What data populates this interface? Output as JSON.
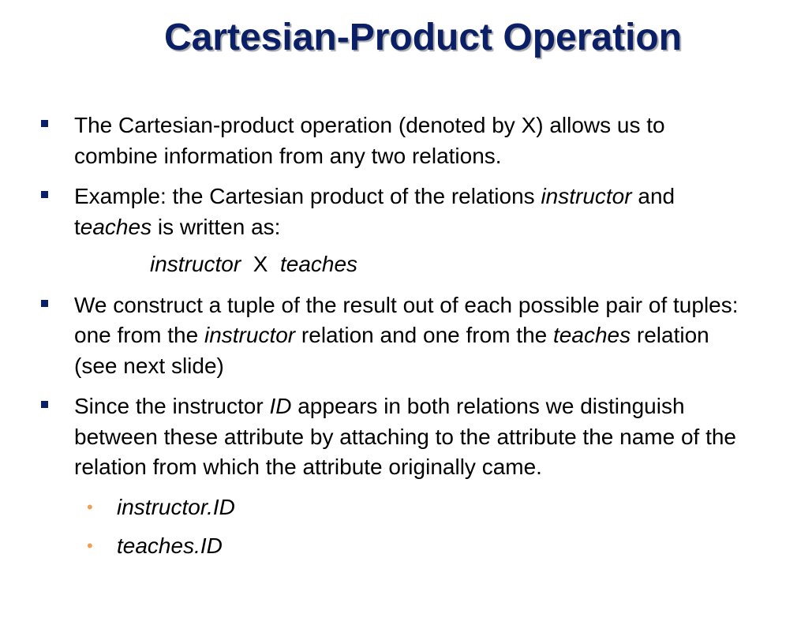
{
  "title": "Cartesian-Product Operation",
  "bullets": [
    {
      "text": "The Cartesian-product operation (denoted by X)  allows us to combine information from any two relations."
    },
    {
      "parts": [
        "Example: the Cartesian product of the relations ",
        "instructor",
        " and t",
        "eaches",
        " is written  as:"
      ]
    },
    {
      "parts": [
        "We construct a tuple of the result out of each possible pair of tuples: one from the ",
        "instructor",
        " relation and one from the ",
        "teaches",
        " relation (see next slide)"
      ]
    },
    {
      "parts": [
        "Since the instructor ",
        "ID",
        " appears in both relations we distinguish between these attribute by attaching to the attribute the name of the relation from which the attribute originally came."
      ]
    }
  ],
  "formula": {
    "left": "instructor",
    "operator": "X",
    "right": "teaches"
  },
  "sub_bullets": [
    "instructor.ID",
    "teaches.ID"
  ],
  "colors": {
    "title": "#0b1f66",
    "bullet_marker": "#0b1f66",
    "sub_bullet_marker": "#f0a050"
  }
}
